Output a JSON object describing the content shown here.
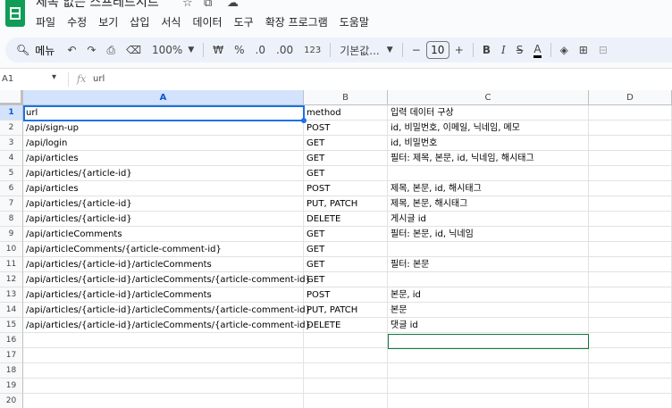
{
  "app": {
    "title": "제목 없는 스프레드시트",
    "menu": [
      "파일",
      "수정",
      "보기",
      "삽입",
      "서식",
      "데이터",
      "도구",
      "확장 프로그램",
      "도움말"
    ]
  },
  "toolbar": {
    "search_label": "메뉴",
    "zoom": "100%",
    "currency": "₩",
    "percent": "%",
    "decimal_decrease": ".0",
    "decimal_increase": ".00",
    "number_format": "123",
    "font": "기본값...",
    "font_size": "10",
    "minus": "−",
    "plus": "+",
    "bold": "B",
    "italic": "I",
    "strike": "S",
    "text_color": "A"
  },
  "formula_bar": {
    "cell_ref": "A1",
    "fx": "fx",
    "value": "url"
  },
  "grid": {
    "columns": [
      "A",
      "B",
      "C",
      "D"
    ],
    "rows": [
      {
        "n": "1",
        "a": "url",
        "b": "method",
        "c": "입력 데이터 구상"
      },
      {
        "n": "2",
        "a": "/api/sign-up",
        "b": "POST",
        "c": "id, 비밀번호, 이메일, 닉네임, 메모"
      },
      {
        "n": "3",
        "a": "/api/login",
        "b": "GET",
        "c": "id, 비밀번호"
      },
      {
        "n": "4",
        "a": "/api/articles",
        "b": "GET",
        "c": "필터: 제목, 본문, id, 닉네임, 해시태그"
      },
      {
        "n": "5",
        "a": "/api/articles/{article-id}",
        "b": "GET",
        "c": ""
      },
      {
        "n": "6",
        "a": "/api/articles",
        "b": "POST",
        "c": "제목, 본문, id, 해시태그"
      },
      {
        "n": "7",
        "a": "/api/articles/{article-id}",
        "b": "PUT, PATCH",
        "c": "제목, 본문, 해시태그"
      },
      {
        "n": "8",
        "a": "/api/articles/{article-id}",
        "b": "DELETE",
        "c": "게시글 id"
      },
      {
        "n": "9",
        "a": "/api/articleComments",
        "b": "GET",
        "c": "필터: 본문, id, 닉네임"
      },
      {
        "n": "10",
        "a": "/api/articleComments/{article-comment-id}",
        "b": "GET",
        "c": ""
      },
      {
        "n": "11",
        "a": "/api/articles/{article-id}/articleComments",
        "b": "GET",
        "c": "필터: 본문"
      },
      {
        "n": "12",
        "a": "/api/articles/{article-id}/articleComments/{article-comment-id}",
        "b": "GET",
        "c": ""
      },
      {
        "n": "13",
        "a": "/api/articles/{article-id}/articleComments",
        "b": "POST",
        "c": "본문, id"
      },
      {
        "n": "14",
        "a": "/api/articles/{article-id}/articleComments/{article-comment-id}",
        "b": "PUT, PATCH",
        "c": "본문"
      },
      {
        "n": "15",
        "a": "/api/articles/{article-id}/articleComments/{article-comment-id}",
        "b": "DELETE",
        "c": "댓글 id"
      },
      {
        "n": "16",
        "a": "",
        "b": "",
        "c": ""
      },
      {
        "n": "17",
        "a": "",
        "b": "",
        "c": ""
      },
      {
        "n": "18",
        "a": "",
        "b": "",
        "c": ""
      },
      {
        "n": "19",
        "a": "",
        "b": "",
        "c": ""
      },
      {
        "n": "20",
        "a": "",
        "b": "",
        "c": ""
      }
    ]
  }
}
